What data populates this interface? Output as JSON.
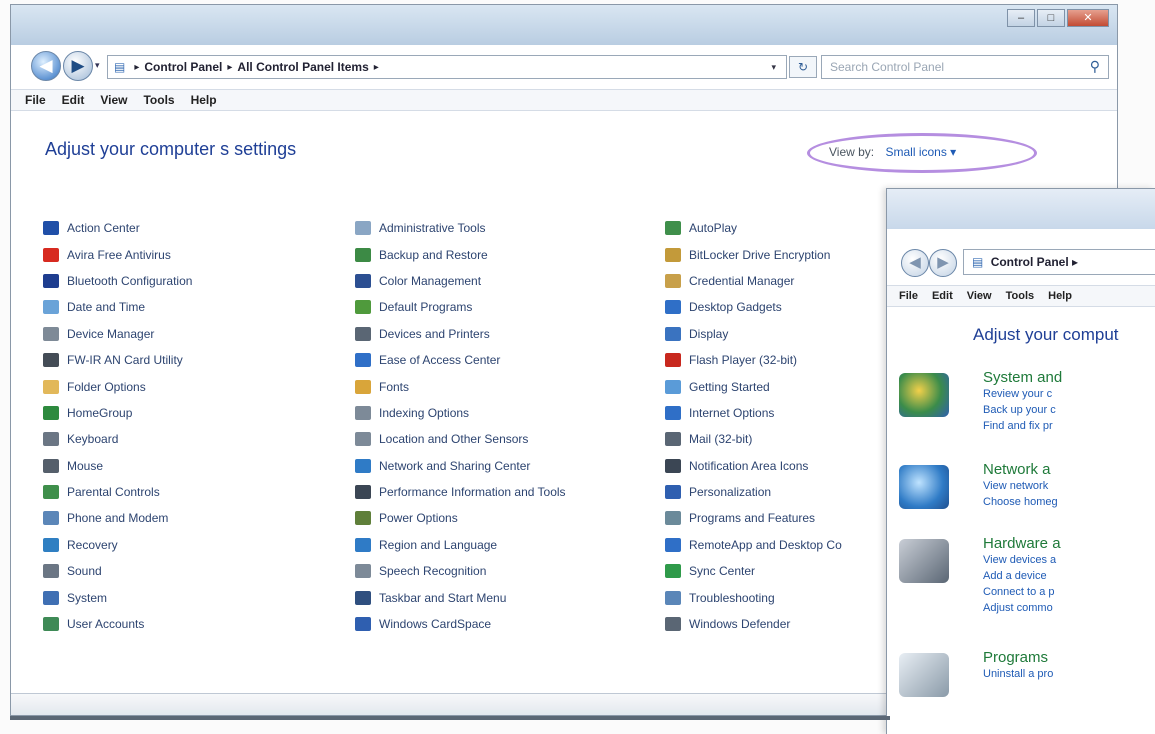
{
  "main_window": {
    "address": {
      "crumbs": [
        "Control Panel",
        "All Control Panel Items"
      ],
      "separator": "▸"
    },
    "search_placeholder": "Search Control Panel",
    "menu": [
      "File",
      "Edit",
      "View",
      "Tools",
      "Help"
    ],
    "heading": "Adjust your computer s settings",
    "view_by_label": "View by:",
    "view_by_value": "Small icons ▾",
    "columns": [
      [
        {
          "label": "Action Center",
          "icon": "flag-icon",
          "color": "#1f4fa8"
        },
        {
          "label": "Avira Free Antivirus",
          "icon": "antivirus-icon",
          "color": "#d72a20"
        },
        {
          "label": "Bluetooth Configuration",
          "icon": "bluetooth-icon",
          "color": "#1e3d8f"
        },
        {
          "label": "Date and Time",
          "icon": "clock-icon",
          "color": "#6aa3d8"
        },
        {
          "label": "Device Manager",
          "icon": "device-manager-icon",
          "color": "#7e8a97"
        },
        {
          "label": "FW-IR AN Card Utility",
          "icon": "card-utility-icon",
          "color": "#444c56"
        },
        {
          "label": "Folder Options",
          "icon": "folder-icon",
          "color": "#e2b85a"
        },
        {
          "label": "HomeGroup",
          "icon": "homegroup-icon",
          "color": "#2d8a3e"
        },
        {
          "label": "Keyboard",
          "icon": "keyboard-icon",
          "color": "#6b7684"
        },
        {
          "label": "Mouse",
          "icon": "mouse-icon",
          "color": "#555f6b"
        },
        {
          "label": "Parental Controls",
          "icon": "parental-controls-icon",
          "color": "#3f8f4b"
        },
        {
          "label": "Phone and Modem",
          "icon": "phone-icon",
          "color": "#5b86b8"
        },
        {
          "label": "Recovery",
          "icon": "recovery-icon",
          "color": "#2f7fc2"
        },
        {
          "label": "Sound",
          "icon": "speaker-icon",
          "color": "#6b7684"
        },
        {
          "label": "System",
          "icon": "system-icon",
          "color": "#3f6fb3"
        },
        {
          "label": "User Accounts",
          "icon": "user-accounts-icon",
          "color": "#3e8a56"
        }
      ],
      [
        {
          "label": "Administrative Tools",
          "icon": "admin-tools-icon",
          "color": "#8aa6c4"
        },
        {
          "label": "Backup and Restore",
          "icon": "backup-icon",
          "color": "#3c8a45"
        },
        {
          "label": "Color Management",
          "icon": "color-management-icon",
          "color": "#2c4f92"
        },
        {
          "label": "Default Programs",
          "icon": "default-programs-icon",
          "color": "#4f9a3c"
        },
        {
          "label": "Devices and Printers",
          "icon": "printer-icon",
          "color": "#5a6674"
        },
        {
          "label": "Ease of Access Center",
          "icon": "ease-of-access-icon",
          "color": "#2f6fc7"
        },
        {
          "label": "Fonts",
          "icon": "fonts-icon",
          "color": "#d9a53a"
        },
        {
          "label": "Indexing Options",
          "icon": "indexing-icon",
          "color": "#7d8a98"
        },
        {
          "label": "Location and Other Sensors",
          "icon": "sensors-icon",
          "color": "#7d8a98"
        },
        {
          "label": "Network and Sharing Center",
          "icon": "network-icon",
          "color": "#2f7bc6"
        },
        {
          "label": "Performance Information and Tools",
          "icon": "performance-icon",
          "color": "#3b4654"
        },
        {
          "label": "Power Options",
          "icon": "power-icon",
          "color": "#5f7f3a"
        },
        {
          "label": "Region and Language",
          "icon": "globe-icon",
          "color": "#2f7bc6"
        },
        {
          "label": "Speech Recognition",
          "icon": "microphone-icon",
          "color": "#7d8a98"
        },
        {
          "label": "Taskbar and Start Menu",
          "icon": "taskbar-icon",
          "color": "#2f4f7f"
        },
        {
          "label": "Windows CardSpace",
          "icon": "cardspace-icon",
          "color": "#2f5fb0"
        }
      ],
      [
        {
          "label": "AutoPlay",
          "icon": "autoplay-icon",
          "color": "#3f8f4b"
        },
        {
          "label": "BitLocker Drive Encryption",
          "icon": "bitlocker-icon",
          "color": "#c39a3a"
        },
        {
          "label": "Credential Manager",
          "icon": "credential-icon",
          "color": "#c8a04a"
        },
        {
          "label": "Desktop Gadgets",
          "icon": "gadgets-icon",
          "color": "#2f6fc7"
        },
        {
          "label": "Display",
          "icon": "display-icon",
          "color": "#3a73c0"
        },
        {
          "label": "Flash Player (32-bit)",
          "icon": "flash-icon",
          "color": "#c8281e"
        },
        {
          "label": "Getting Started",
          "icon": "getting-started-icon",
          "color": "#5a9bd8"
        },
        {
          "label": "Internet Options",
          "icon": "internet-options-icon",
          "color": "#2f6fc7"
        },
        {
          "label": "Mail (32-bit)",
          "icon": "mail-icon",
          "color": "#5a6674"
        },
        {
          "label": "Notification Area Icons",
          "icon": "notification-icon",
          "color": "#3b4654"
        },
        {
          "label": "Personalization",
          "icon": "personalization-icon",
          "color": "#2f5fb0"
        },
        {
          "label": "Programs and Features",
          "icon": "programs-icon",
          "color": "#6b8a9a"
        },
        {
          "label": "RemoteApp and Desktop Co",
          "icon": "remoteapp-icon",
          "color": "#2f6fc7"
        },
        {
          "label": "Sync Center",
          "icon": "sync-icon",
          "color": "#2f9a4a"
        },
        {
          "label": "Troubleshooting",
          "icon": "troubleshooting-icon",
          "color": "#5a86b8"
        },
        {
          "label": "Windows Defender",
          "icon": "defender-icon",
          "color": "#5a6674"
        }
      ]
    ]
  },
  "overlay_window": {
    "address": "Control Panel ▸",
    "menu": [
      "File",
      "Edit",
      "View",
      "Tools",
      "Help"
    ],
    "heading": "Adjust your comput",
    "categories": [
      {
        "title": "System and",
        "icon": "system-security-icon",
        "links": [
          "Review your c",
          "Back up your c",
          "Find and fix pr"
        ]
      },
      {
        "title": "Network a",
        "icon": "network-internet-icon",
        "links": [
          "View network",
          "Choose homeg"
        ]
      },
      {
        "title": "Hardware a",
        "icon": "hardware-sound-icon",
        "links": [
          "View devices a",
          "Add a device",
          "Connect to a p",
          "Adjust commo"
        ]
      },
      {
        "title": "Programs",
        "icon": "programs-category-icon",
        "links": [
          "Uninstall a pro"
        ]
      }
    ]
  }
}
